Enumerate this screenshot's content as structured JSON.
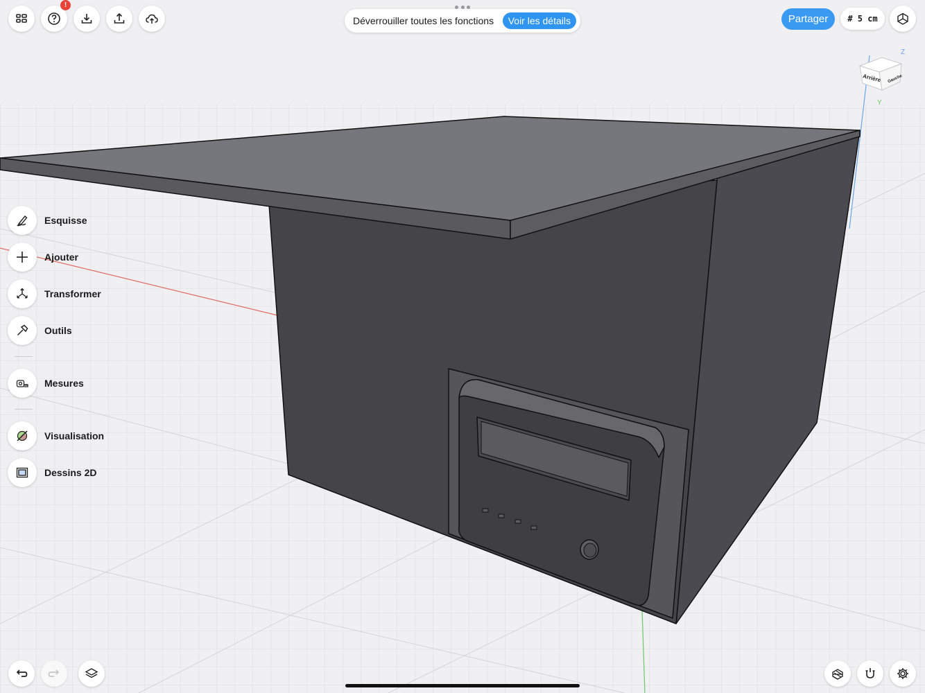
{
  "toolbar": {
    "help_badge": "!",
    "unlock_text": "Déverrouiller toutes les fonctions",
    "details_label": "Voir les détails",
    "share_label": "Partager",
    "grid_label": "# 5 cm"
  },
  "view_cube": {
    "face_back": "Arrière",
    "face_left": "Gauche",
    "axis_z": "Z",
    "axis_y": "Y"
  },
  "sidebar": {
    "items": [
      {
        "label": "Esquisse",
        "icon": "pencil-icon"
      },
      {
        "label": "Ajouter",
        "icon": "plus-icon"
      },
      {
        "label": "Transformer",
        "icon": "transform-icon"
      },
      {
        "label": "Outils",
        "icon": "hammer-icon"
      },
      {
        "label": "Mesures",
        "icon": "tape-measure-icon"
      },
      {
        "label": "Visualisation",
        "icon": "visualization-icon"
      },
      {
        "label": "Dessins 2D",
        "icon": "drawing-2d-icon"
      }
    ]
  },
  "bottom_toolbar": {
    "left": [
      "undo-icon",
      "redo-icon",
      "layers-icon"
    ],
    "right": [
      "material-icon",
      "snap-magnet-icon",
      "settings-gear-icon"
    ]
  },
  "colors": {
    "accent": "#3a9af2",
    "badge": "#e8443a",
    "grid_bg": "#f0f0f2",
    "model_dark": "#46454b",
    "model_top": "#76777c"
  }
}
